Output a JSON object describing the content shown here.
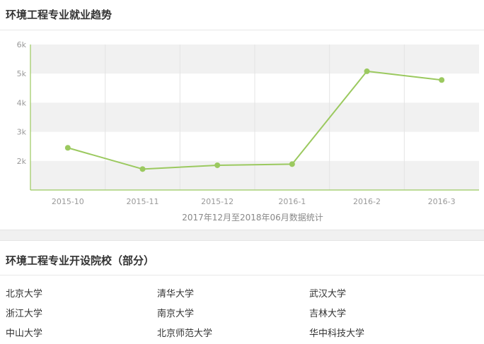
{
  "sections": {
    "trend_title": "环境工程专业就业趋势",
    "schools_title": "环境工程专业开设院校（部分）"
  },
  "chart_data": {
    "type": "line",
    "categories": [
      "2015-10",
      "2015-11",
      "2015-12",
      "2016-1",
      "2016-2",
      "2016-3"
    ],
    "values": [
      2450,
      1720,
      1850,
      1890,
      5080,
      4780
    ],
    "yticks": [
      2000,
      3000,
      4000,
      5000,
      6000
    ],
    "ytick_labels": [
      "2k",
      "3k",
      "4k",
      "5k",
      "6k"
    ],
    "ylim": [
      1000,
      6000
    ],
    "xlabel": "2017年12月至2018年06月数据统计",
    "colors": {
      "line": "#9bc95f",
      "axis": "#9bc95f",
      "band": "#f1f1f1",
      "grid": "#e4e4e4",
      "tick_text": "#999999",
      "xlabel_text": "#888888"
    },
    "grid": true
  },
  "schools": [
    [
      "北京大学",
      "清华大学",
      "武汉大学"
    ],
    [
      "浙江大学",
      "南京大学",
      "吉林大学"
    ],
    [
      "中山大学",
      "北京师范大学",
      "华中科技大学"
    ]
  ]
}
